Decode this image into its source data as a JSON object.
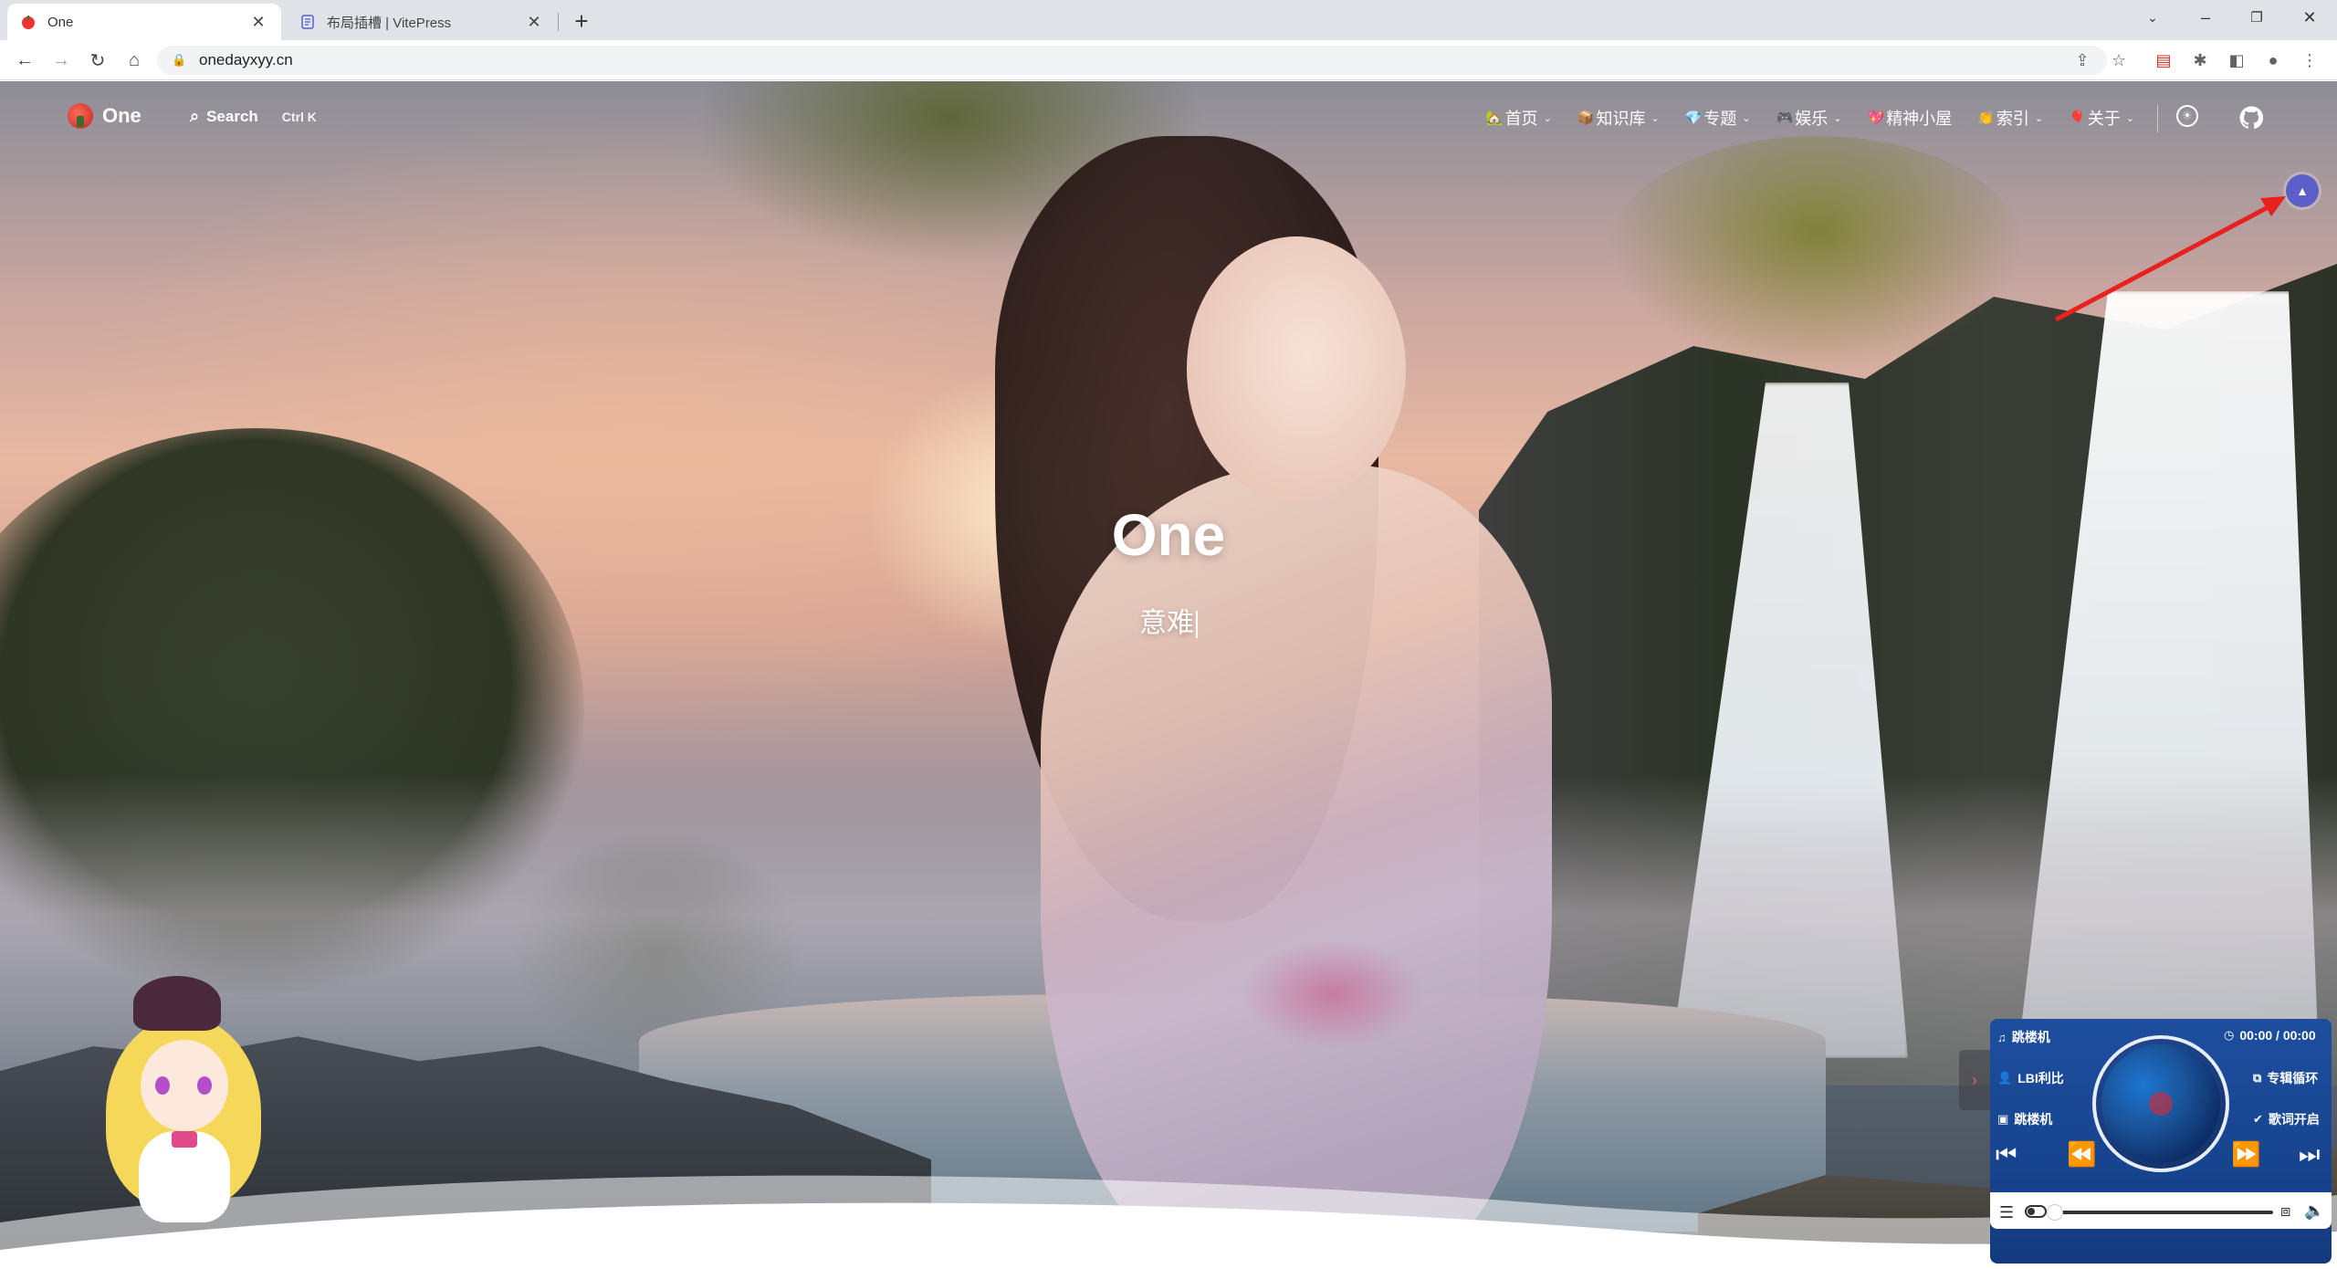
{
  "browser": {
    "tabs": [
      {
        "title": "One",
        "active": true,
        "favicon": "tomato-logo-icon"
      },
      {
        "title": "布局插槽 | VitePress",
        "active": false,
        "favicon": "vitepress-doc-icon"
      }
    ],
    "url": "onedayxyy.cn"
  },
  "site": {
    "brand": "One",
    "search_label": "Search",
    "search_shortcut": "Ctrl K",
    "menu": [
      {
        "label": "首页",
        "emoji": "🏡",
        "has_dropdown": true
      },
      {
        "label": "知识库",
        "emoji": "📦",
        "has_dropdown": true
      },
      {
        "label": "专题",
        "emoji": "💎",
        "has_dropdown": true
      },
      {
        "label": "娱乐",
        "emoji": "🎮",
        "has_dropdown": true
      },
      {
        "label": "精神小屋",
        "emoji": "💖",
        "has_dropdown": false
      },
      {
        "label": "索引",
        "emoji": "👏",
        "has_dropdown": true
      },
      {
        "label": "关于",
        "emoji": "🎈",
        "has_dropdown": true
      }
    ]
  },
  "hero": {
    "title": "One",
    "subtitle": "意难"
  },
  "player": {
    "song": "跳楼机",
    "artist": "LBI利比",
    "album": "跳楼机",
    "time": "00:00 / 00:00",
    "mode": "专辑循环",
    "lyrics": "歌词开启"
  },
  "colors": {
    "accent_purple": "#5b5fc7",
    "player_blue": "#1d4e9e",
    "annotation_red": "#e8201e"
  }
}
